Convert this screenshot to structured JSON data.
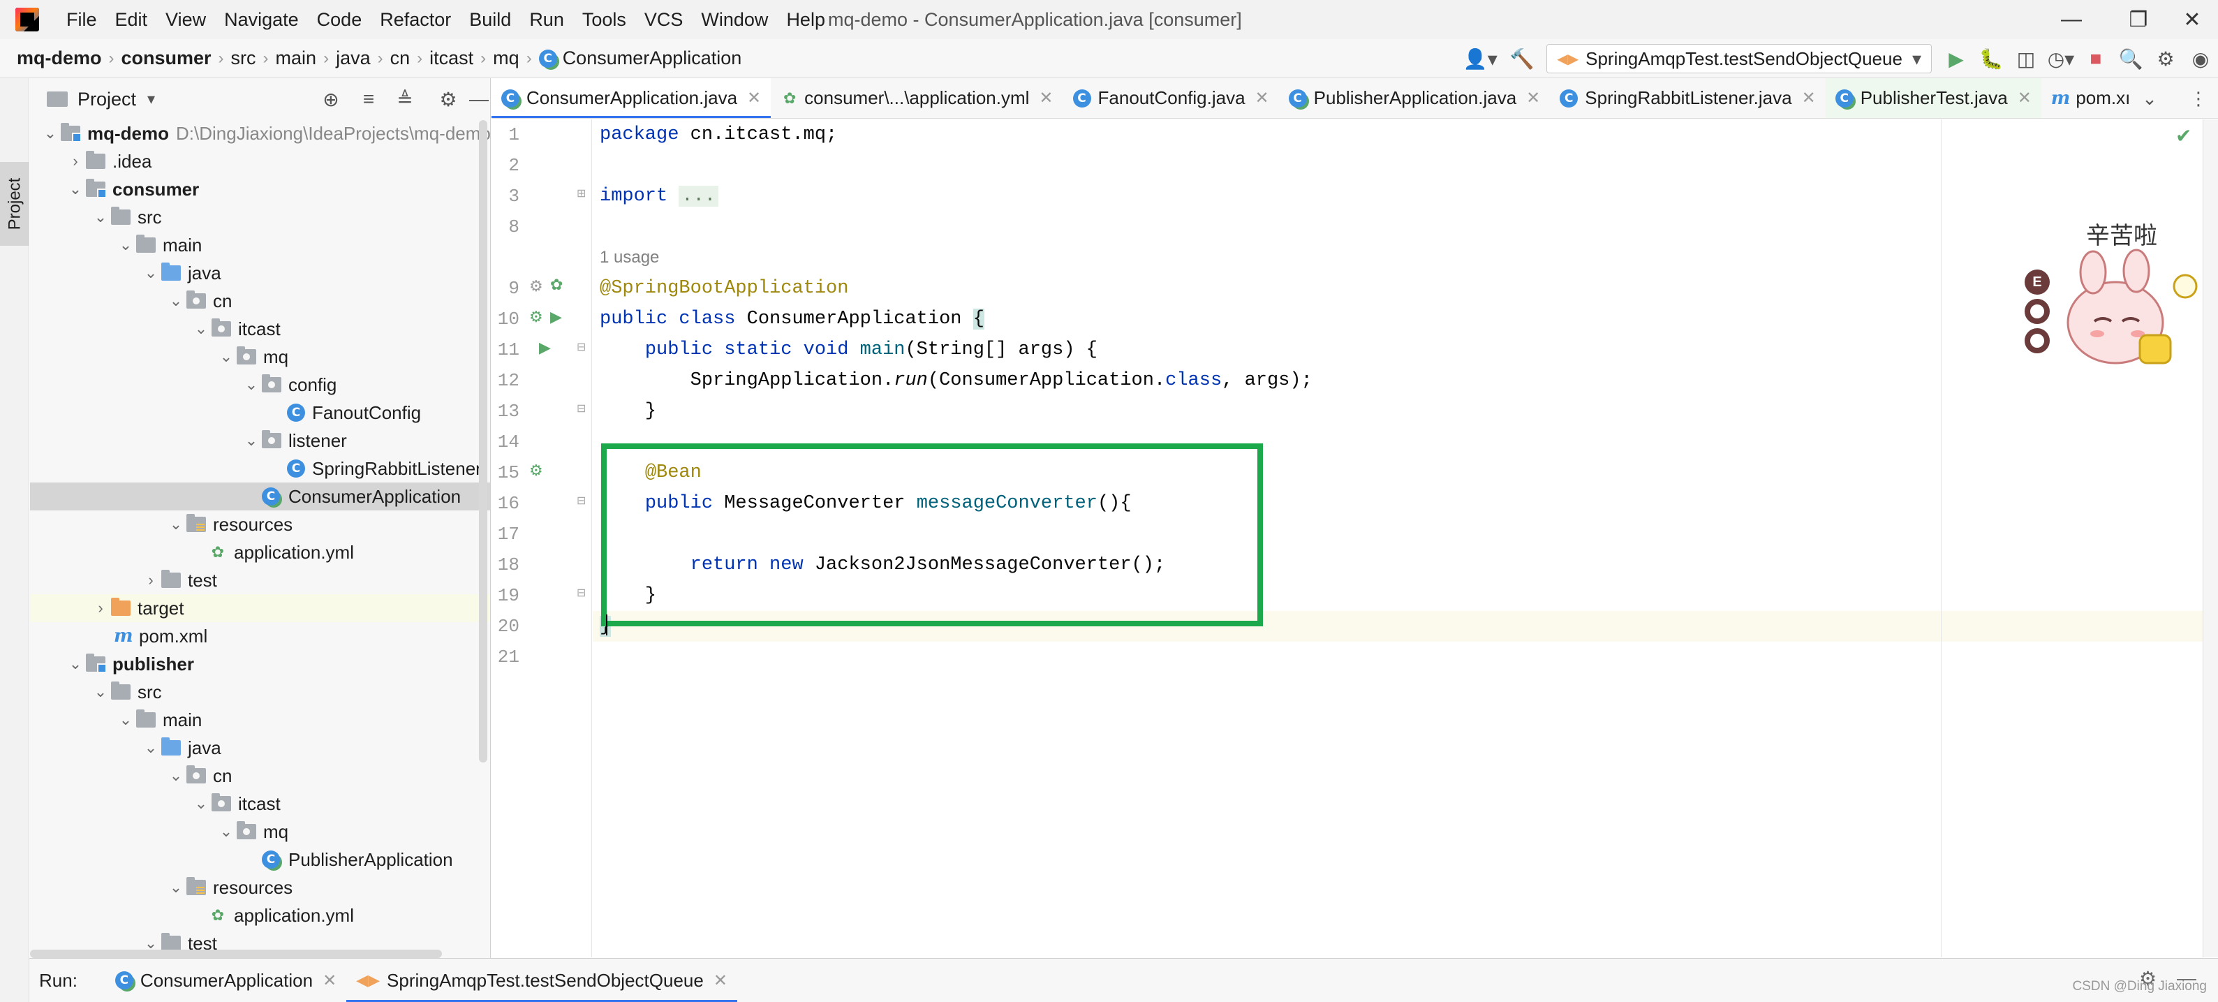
{
  "menubar": {
    "items": [
      "File",
      "Edit",
      "View",
      "Navigate",
      "Code",
      "Refactor",
      "Build",
      "Run",
      "Tools",
      "VCS",
      "Window",
      "Help"
    ],
    "window_title": "mq-demo - ConsumerApplication.java [consumer]"
  },
  "navbar": {
    "breadcrumb": [
      "mq-demo",
      "consumer",
      "src",
      "main",
      "java",
      "cn",
      "itcast",
      "mq",
      "ConsumerApplication"
    ],
    "run_config": "SpringAmqpTest.testSendObjectQueue"
  },
  "project_panel": {
    "title": "Project",
    "strip_label": "Project",
    "tree": [
      {
        "label": "mq-demo",
        "path": "D:\\DingJiaxiong\\IdeaProjects\\mq-demo",
        "icon": "module-folder-icon",
        "chevron": "down"
      },
      {
        "label": ".idea",
        "icon": "folder-icon",
        "chevron": "right"
      },
      {
        "label": "consumer",
        "icon": "module-folder-icon",
        "chevron": "down"
      },
      {
        "label": "src",
        "icon": "folder-icon",
        "chevron": "down"
      },
      {
        "label": "main",
        "icon": "folder-icon",
        "chevron": "down"
      },
      {
        "label": "java",
        "icon": "source-folder-icon",
        "chevron": "down"
      },
      {
        "label": "cn",
        "icon": "package-icon",
        "chevron": "down"
      },
      {
        "label": "itcast",
        "icon": "package-icon",
        "chevron": "down"
      },
      {
        "label": "mq",
        "icon": "package-icon",
        "chevron": "down"
      },
      {
        "label": "config",
        "icon": "package-icon",
        "chevron": "down"
      },
      {
        "label": "FanoutConfig",
        "icon": "class-icon",
        "chevron": ""
      },
      {
        "label": "listener",
        "icon": "package-icon",
        "chevron": "down"
      },
      {
        "label": "SpringRabbitListener",
        "icon": "class-icon",
        "chevron": ""
      },
      {
        "label": "ConsumerApplication",
        "icon": "spring-boot-class-icon",
        "chevron": ""
      },
      {
        "label": "resources",
        "icon": "resources-folder-icon",
        "chevron": "down"
      },
      {
        "label": "application.yml",
        "icon": "yml-file-icon",
        "chevron": ""
      },
      {
        "label": "test",
        "icon": "folder-icon",
        "chevron": "right"
      },
      {
        "label": "target",
        "icon": "target-folder-icon",
        "chevron": "right"
      },
      {
        "label": "pom.xml",
        "icon": "maven-icon",
        "chevron": ""
      },
      {
        "label": "publisher",
        "icon": "module-folder-icon",
        "chevron": "down"
      },
      {
        "label": "src",
        "icon": "folder-icon",
        "chevron": "down"
      },
      {
        "label": "main",
        "icon": "folder-icon",
        "chevron": "down"
      },
      {
        "label": "java",
        "icon": "source-folder-icon",
        "chevron": "down"
      },
      {
        "label": "cn",
        "icon": "package-icon",
        "chevron": "down"
      },
      {
        "label": "itcast",
        "icon": "package-icon",
        "chevron": "down"
      },
      {
        "label": "mq",
        "icon": "package-icon",
        "chevron": "down"
      },
      {
        "label": "PublisherApplication",
        "icon": "spring-boot-class-icon",
        "chevron": ""
      },
      {
        "label": "resources",
        "icon": "resources-folder-icon",
        "chevron": "down"
      },
      {
        "label": "application.yml",
        "icon": "yml-file-icon",
        "chevron": ""
      },
      {
        "label": "test",
        "icon": "folder-icon",
        "chevron": "down"
      }
    ]
  },
  "editor": {
    "tabs": [
      {
        "label": "ConsumerApplication.java",
        "icon": "spring-boot-class-icon"
      },
      {
        "label": "consumer\\...\\application.yml",
        "icon": "yml-file-icon"
      },
      {
        "label": "FanoutConfig.java",
        "icon": "class-icon"
      },
      {
        "label": "PublisherApplication.java",
        "icon": "spring-boot-class-icon"
      },
      {
        "label": "SpringRabbitListener.java",
        "icon": "class-icon"
      },
      {
        "label": "PublisherTest.java",
        "icon": "spring-boot-class-icon"
      },
      {
        "label": "pom.xı",
        "icon": "maven-icon"
      }
    ],
    "usage_hint": "1 usage",
    "line_numbers": [
      "1",
      "2",
      "3",
      "8",
      "",
      "9",
      "10",
      "11",
      "12",
      "13",
      "14",
      "15",
      "16",
      "17",
      "18",
      "19",
      "20",
      "21"
    ],
    "code": {
      "l1_kw": "package",
      "l1_rest": " cn.itcast.mq;",
      "l3_kw": "import",
      "l3_fold": "...",
      "l9_anno": "@SpringBootApplication",
      "l10_kw": "public class",
      "l10_name": " ConsumerApplication ",
      "l10_brace": "{",
      "l11_kw": "public static void",
      "l11_fn": "main",
      "l11_rest": "(String[] args) {",
      "l12_a": "SpringApplication.",
      "l12_run": "run",
      "l12_b": "(ConsumerApplication.",
      "l12_kw": "class",
      "l12_c": ", args);",
      "l13": "}",
      "l15_anno": "@Bean",
      "l16_kw": "public",
      "l16_type": " MessageConverter ",
      "l16_fn": "messageConverter",
      "l16_rest": "(){",
      "l18_kw1": "return",
      "l18_kw2": "new",
      "l18_rest": " Jackson2JsonMessageConverter();",
      "l19": "}",
      "l20": "}"
    },
    "sticker_text": "辛苦啦",
    "sticker_badges": [
      "E",
      "",
      ""
    ]
  },
  "run_bar": {
    "label": "Run:",
    "tabs": [
      "ConsumerApplication",
      "SpringAmqpTest.testSendObjectQueue"
    ]
  },
  "watermark": "CSDN @Ding Jiaxiong",
  "colors": {
    "highlight_box": "#1ba94c",
    "accent": "#3574f0"
  }
}
